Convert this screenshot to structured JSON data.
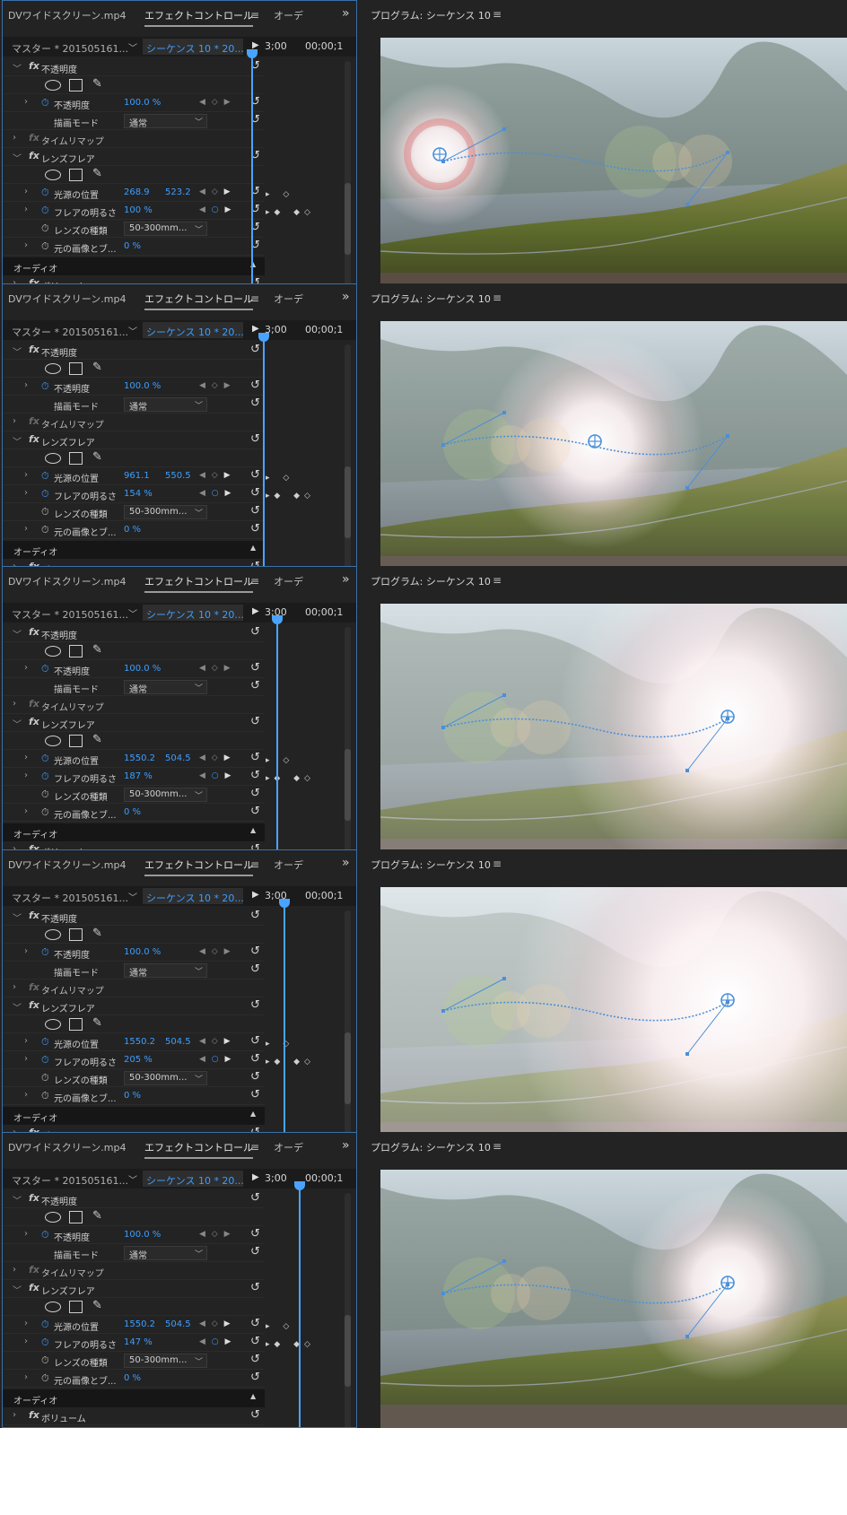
{
  "tabs": {
    "source": "DVワイドスクリーン.mp4",
    "effect_controls": "エフェクトコントロール",
    "audio_truncated": "オーデ",
    "more": "»",
    "menu": "≡"
  },
  "source_row": {
    "master": "マスター * 201505161...",
    "sequence": "シーケンス 10 * 20...",
    "tc_left": "3;00",
    "tc_right": "00;00;1"
  },
  "effects": {
    "opacity_group": "不透明度",
    "opacity_prop": "不透明度",
    "opacity_value": "100.0 %",
    "blend_mode_label": "描画モード",
    "blend_mode_value": "通常",
    "time_remap": "タイムリマップ",
    "lens_flare_group": "レンズフレア",
    "flare_center": "光源の位置",
    "flare_brightness": "フレアの明るさ",
    "lens_type": "レンズの種類",
    "lens_type_value": "50-300mm...",
    "blend_original": "元の画像とブ...",
    "blend_original_value": "0 %",
    "audio_section": "オーディオ",
    "volume": "ボリューム"
  },
  "program": {
    "title": "プログラム: シーケンス 10"
  },
  "frames": [
    {
      "pos_x": "268.9",
      "pos_y": "523.2",
      "brightness": "100 %"
    },
    {
      "pos_x": "961.1",
      "pos_y": "550.5",
      "brightness": "154 %"
    },
    {
      "pos_x": "1550.2",
      "pos_y": "504.5",
      "brightness": "187 %"
    },
    {
      "pos_x": "1550.2",
      "pos_y": "504.5",
      "brightness": "205 %"
    },
    {
      "pos_x": "1550.2",
      "pos_y": "504.5",
      "brightness": "147 %"
    }
  ],
  "colors": {
    "accent": "#3d9eff",
    "panel_bg": "#232323",
    "panel_border": "#3b6fa8"
  },
  "icons": [
    "twirl-icon",
    "fx-icon",
    "ellipse-mask-icon",
    "rectangle-mask-icon",
    "pen-mask-icon",
    "stopwatch-icon",
    "reset-icon",
    "keyframe-icon",
    "dropdown-arrow-icon",
    "play-icon",
    "panel-menu-icon",
    "crosshair-icon"
  ]
}
